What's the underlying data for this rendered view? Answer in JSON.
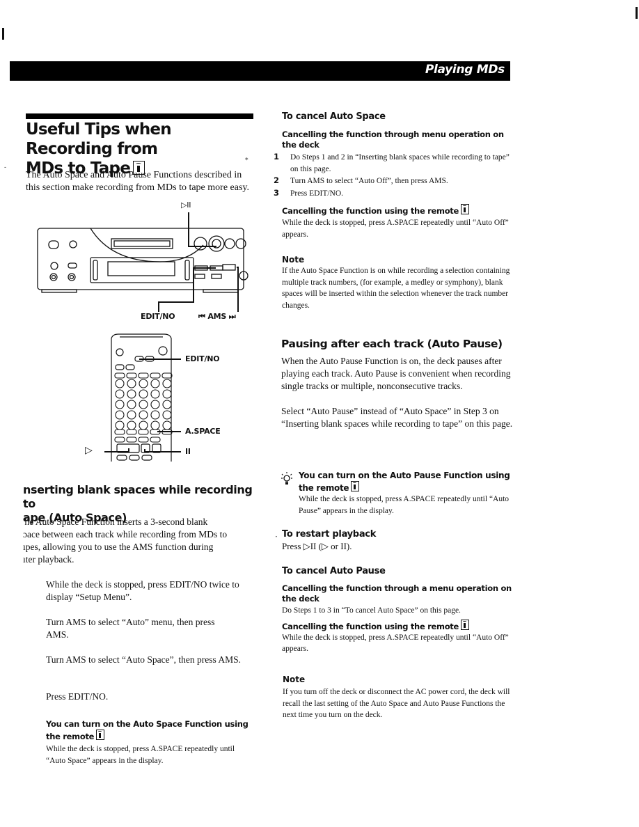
{
  "header": {
    "section_title": "Playing MDs"
  },
  "left_column": {
    "title_line1": "Useful Tips when Recording from",
    "title_line2": "MDs to Tape",
    "title_icon": "remote-icon",
    "intro": "The Auto Space and Auto Pause Functions described in this section make recording from MDs to tape more easy.",
    "deck_figure": {
      "play_pause_label": "▷II",
      "edit_no_label": "EDIT/NO",
      "ams_label": "⏮ AMS ⏭"
    },
    "remote_figure": {
      "edit_no_label": "EDIT/NO",
      "aspace_label": "A.SPACE",
      "pause_label": "II",
      "play_label": "▷"
    },
    "section_heading_line1": "nserting blank spaces while recording to",
    "section_heading_line2": "ape (Auto Space)",
    "section_body": [
      "'he Auto Space Function inserts a 3-second blank",
      "ɔace between each track while recording from MDs to",
      "ıpes, allowing you to use the AMS function during",
      "ıter playback."
    ],
    "steps": [
      "While the deck is stopped, press EDIT/NO twice to display “Setup Menu”.",
      "Turn AMS to select “Auto” menu, then press AMS.",
      "Turn AMS to select “Auto Space”, then press AMS.",
      "Press EDIT/NO."
    ],
    "tip": {
      "heading": "You can turn on the Auto Space Function using the remote",
      "body": "While the deck is stopped, press A.SPACE repeatedly until “Auto Space” appears in the display."
    }
  },
  "right_column": {
    "cancel_space": {
      "heading": "To cancel Auto Space",
      "menu_heading": "Cancelling the function through menu operation on the deck",
      "steps": [
        {
          "num": "1",
          "text": "Do Steps 1 and 2 in “Inserting blank spaces while recording to tape” on this page."
        },
        {
          "num": "2",
          "text": "Turn AMS to select “Auto Off”, then press AMS."
        },
        {
          "num": "3",
          "text": "Press EDIT/NO."
        }
      ],
      "remote_heading": "Cancelling the function using the remote",
      "remote_body": "While the deck is stopped, press A.SPACE repeatedly until “Auto Off” appears."
    },
    "note1": {
      "heading": "Note",
      "body": "If the Auto Space Function is on while recording a selection containing multiple track numbers, (for example, a medley or symphony), blank spaces will be inserted within the selection whenever the track number changes."
    },
    "auto_pause": {
      "heading": "Pausing after each track (Auto Pause)",
      "body1": "When the Auto Pause Function is on, the deck pauses after playing each track.  Auto Pause is convenient when recording single tracks or multiple, nonconsecutive tracks.",
      "body2": "Select “Auto Pause” instead of “Auto Space” in Step 3 on “Inserting blank spaces while recording to tape” on this page."
    },
    "tip": {
      "icon": "lightbulb-icon",
      "heading": "You can turn on the Auto Pause Function using the remote",
      "body": "While the deck is stopped, press A.SPACE repeatedly until “Auto Pause” appears in the display."
    },
    "restart": {
      "heading": "To restart playback",
      "body": "Press ▷II (▷ or II)."
    },
    "cancel_pause": {
      "heading": "To cancel Auto Pause",
      "menu_heading": "Cancelling the function through a menu operation on the deck",
      "menu_body": "Do Steps 1 to 3 in “To cancel Auto Space” on this page.",
      "remote_heading": "Cancelling the function using the remote",
      "remote_body": "While the deck is stopped, press A.SPACE repeatedly until “Auto Off” appears."
    },
    "note2": {
      "heading": "Note",
      "body": "If you turn off the deck or disconnect the AC power cord, the deck will recall the last setting of the Auto Space and Auto Pause Functions the next time you turn on the deck."
    }
  }
}
